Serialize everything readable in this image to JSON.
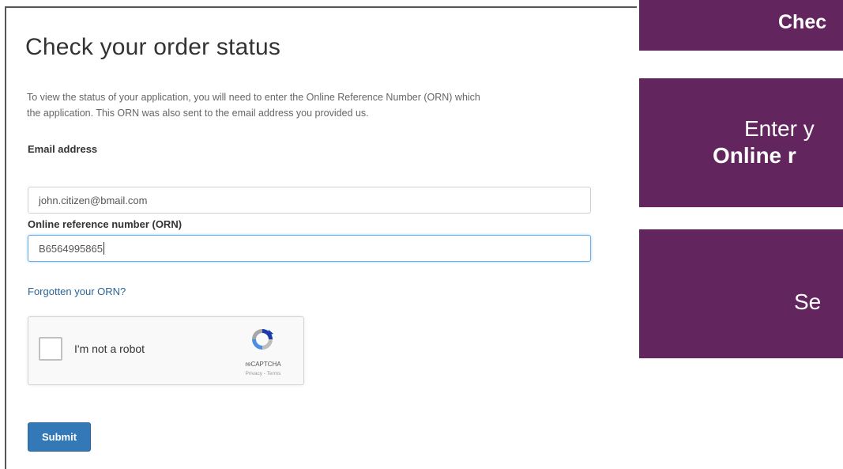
{
  "form": {
    "title": "Check your order status",
    "intro_line1": "To view the status of your application, you will need to enter the Online Reference Number (ORN) which",
    "intro_line2": "the application. This ORN was also sent to the email address you provided us.",
    "email_label": "Email address",
    "email_value": "john.citizen@bmail.com",
    "orn_label": "Online reference number (ORN)",
    "orn_value": "B6564995865",
    "forgot_link": "Forgotten your ORN?",
    "recaptcha": {
      "label": "I'm not a robot",
      "brand": "reCAPTCHA",
      "terms": "Privacy - Terms",
      "checked": false
    },
    "submit_label": "Submit"
  },
  "callouts": [
    {
      "line1": "Chec"
    },
    {
      "line1": "Enter y",
      "line2": "Online r"
    },
    {
      "line1": "Se"
    }
  ],
  "colors": {
    "callout_bg": "#63255e",
    "submit_bg": "#3479b7",
    "link": "#2a6496"
  }
}
